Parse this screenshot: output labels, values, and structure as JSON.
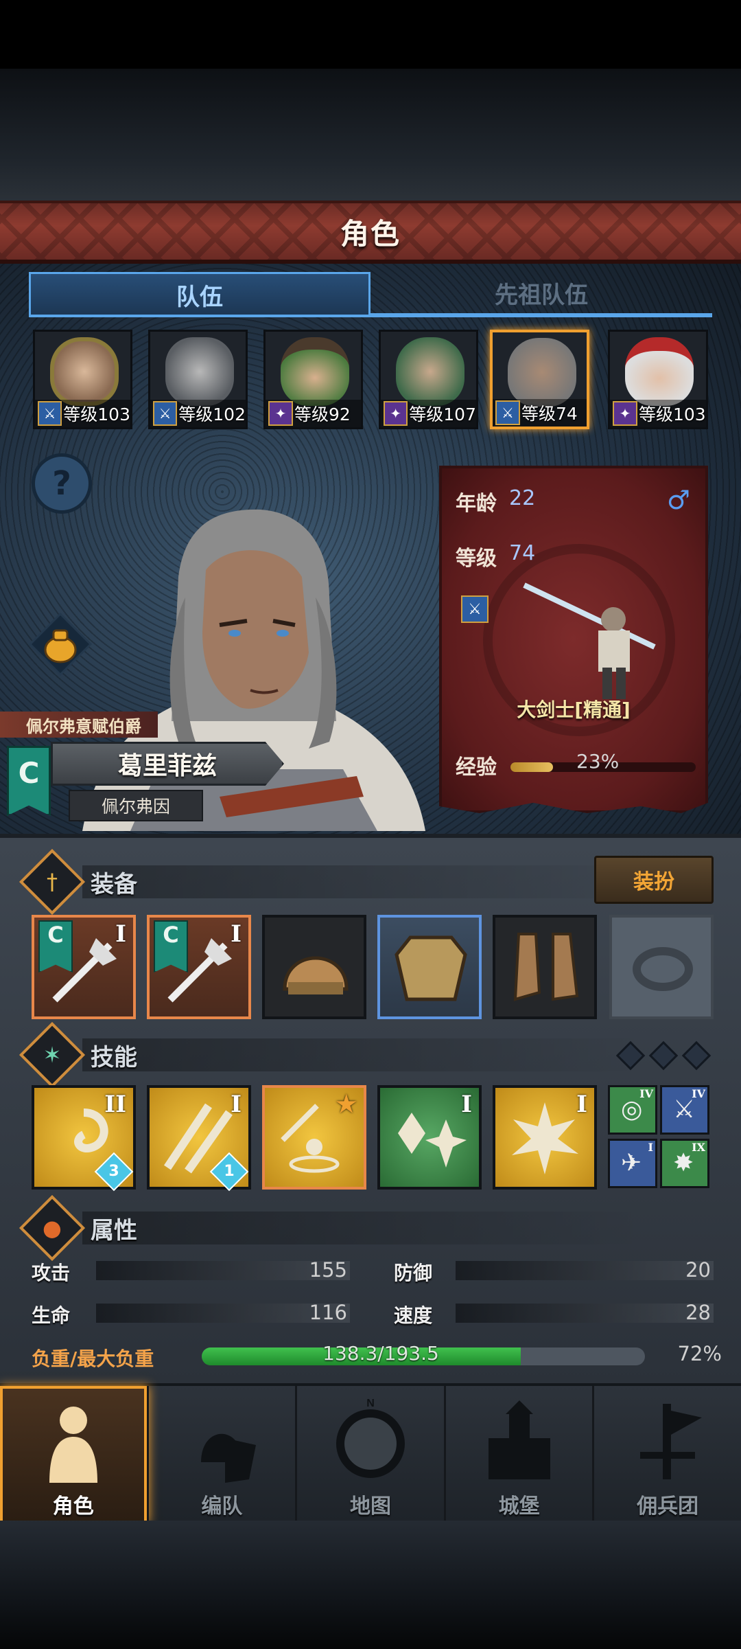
{
  "title": "角色",
  "tabs": [
    {
      "label": "队伍",
      "active": true
    },
    {
      "label": "先祖队伍",
      "active": false
    }
  ],
  "party": [
    {
      "level_text": "等级103",
      "class": "blue",
      "icon": "sword-icon"
    },
    {
      "level_text": "等级102",
      "class": "blue",
      "icon": "sword-icon"
    },
    {
      "level_text": "等级92",
      "class": "purple",
      "icon": "staff-icon"
    },
    {
      "level_text": "等级107",
      "class": "purple",
      "icon": "staff-icon"
    },
    {
      "level_text": "等级74",
      "class": "blue",
      "icon": "sword-icon",
      "selected": true
    },
    {
      "level_text": "等级103",
      "class": "purple",
      "icon": "staff-icon"
    }
  ],
  "hero": {
    "title": "佩尔弗意赋伯爵",
    "name": "葛里菲兹",
    "origin": "佩尔弗因",
    "banner_letter": "C"
  },
  "info": {
    "age_label": "年龄",
    "age": "22",
    "gender_symbol": "♂",
    "level_label": "等级",
    "level": "74",
    "class_name": "大剑士[精通]",
    "exp_label": "经验",
    "exp_percent": "23%",
    "exp_fraction": 0.23
  },
  "equipment": {
    "label": "装备",
    "outfit_button": "装扮",
    "slots": [
      {
        "kind": "weapon",
        "rank": "I",
        "rarity": "orange"
      },
      {
        "kind": "weapon",
        "rank": "I",
        "rarity": "orange"
      },
      {
        "kind": "helmet",
        "rarity": "none"
      },
      {
        "kind": "armor",
        "rarity": "blue"
      },
      {
        "kind": "boots",
        "rarity": "none"
      },
      {
        "kind": "ring",
        "rarity": "empty"
      }
    ]
  },
  "skills": {
    "label": "技能",
    "items": [
      {
        "rank": "II",
        "gem": "3",
        "color": "gold"
      },
      {
        "rank": "I",
        "gem": "1",
        "color": "gold"
      },
      {
        "rank": "★",
        "color": "gold",
        "selected": true
      },
      {
        "rank": "I",
        "color": "green"
      },
      {
        "rank": "I",
        "color": "gold"
      }
    ],
    "mini": [
      {
        "rank": "IV",
        "color": "green",
        "icon": "target-icon"
      },
      {
        "rank": "IV",
        "color": "blue",
        "icon": "crossed-swords-icon"
      },
      {
        "rank": "I",
        "color": "blue",
        "icon": "bird-icon"
      },
      {
        "rank": "IX",
        "color": "green",
        "icon": "burst-icon"
      }
    ]
  },
  "attributes": {
    "label": "属性",
    "attack_label": "攻击",
    "attack": "155",
    "defense_label": "防御",
    "defense": "20",
    "hp_label": "生命",
    "hp": "116",
    "speed_label": "速度",
    "speed": "28",
    "load_label": "负重/最大负重",
    "load_value": "138.3/193.5",
    "load_percent": "72%",
    "load_fraction": 0.72
  },
  "nav": [
    {
      "label": "角色",
      "active": true
    },
    {
      "label": "编队",
      "active": false
    },
    {
      "label": "地图",
      "active": false
    },
    {
      "label": "城堡",
      "active": false
    },
    {
      "label": "佣兵团",
      "active": false
    }
  ],
  "compass_letter": "N"
}
